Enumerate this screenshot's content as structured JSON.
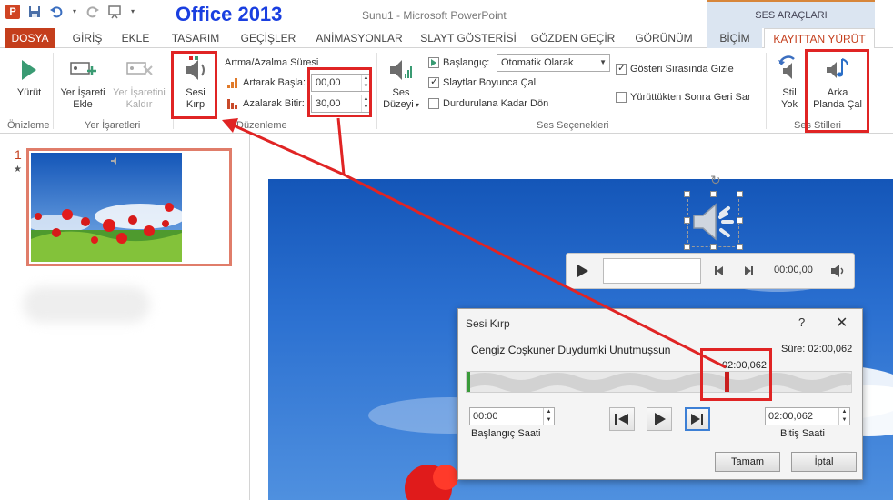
{
  "titlebar": {
    "office_label": "Office 2013",
    "doc_title": "Sunu1 - Microsoft PowerPoint",
    "context_tab_group": "SES ARAÇLARI"
  },
  "tabs": [
    {
      "label": "DOSYA"
    },
    {
      "label": "GİRİŞ"
    },
    {
      "label": "EKLE"
    },
    {
      "label": "TASARIM"
    },
    {
      "label": "GEÇİŞLER"
    },
    {
      "label": "ANİMASYONLAR"
    },
    {
      "label": "SLAYT GÖSTERİSİ"
    },
    {
      "label": "GÖZDEN GEÇİR"
    },
    {
      "label": "GÖRÜNÜM"
    },
    {
      "label": "BİÇİM"
    },
    {
      "label": "KAYITTAN YÜRÜT"
    }
  ],
  "ribbon": {
    "onizleme": {
      "btn": "Yürüt",
      "group": "Önizleme"
    },
    "yer_isaretleri": {
      "add1": "Yer İşareti",
      "add2": "Ekle",
      "remove1": "Yer İşaretini",
      "remove2": "Kaldır",
      "group": "Yer İşaretleri"
    },
    "duzenleme": {
      "trim1": "Sesi",
      "trim2": "Kırp",
      "fade_title": "Artma/Azalma Süresi",
      "fade_in_label": "Artarak Başla:",
      "fade_in_value": "00,00",
      "fade_out_label": "Azalarak Bitir:",
      "fade_out_value": "30,00",
      "group": "Düzenleme"
    },
    "ses_secenekleri": {
      "volume1": "Ses",
      "volume2": "Düzeyi",
      "start_label": "Başlangıç:",
      "start_value": "Otomatik Olarak",
      "across_slides": "Slaytlar Boyunca Çal",
      "loop": "Durdurulana Kadar Dön",
      "hide": "Gösteri Sırasında Gizle",
      "rewind": "Yürüttükten Sonra Geri Sar",
      "group": "Ses Seçenekleri"
    },
    "ses_stilleri": {
      "nostyle1": "Stil",
      "nostyle2": "Yok",
      "bg1": "Arka",
      "bg2": "Planda Çal",
      "group": "Ses Stilleri"
    }
  },
  "slides_panel": {
    "number": "1",
    "star": "★"
  },
  "player": {
    "time": "00:00,00"
  },
  "dialog": {
    "title": "Sesi Kırp",
    "help": "?",
    "close": "✕",
    "song": "Cengiz Coşkuner Duydumki Unutmuşsun",
    "duration": "Süre: 02:00,062",
    "end_marker_time": "02:00,062",
    "start_value": "00:00",
    "start_label": "Başlangıç Saati",
    "end_value": "02:00,062",
    "end_label": "Bitiş Saati",
    "ok": "Tamam",
    "cancel": "İptal"
  }
}
